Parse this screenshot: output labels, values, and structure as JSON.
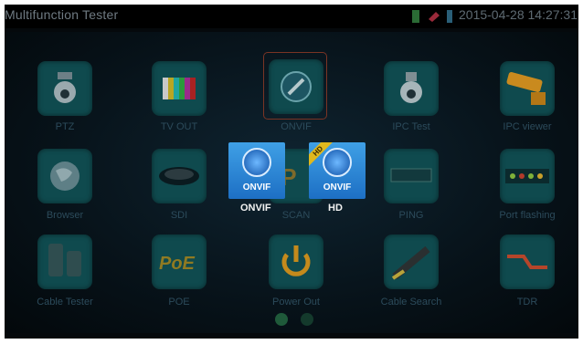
{
  "statusbar": {
    "title": "Multifunction Tester",
    "datetime": "2015-04-28 14:27:31",
    "icons": [
      "battery-icon",
      "charge-icon",
      "signal-icon"
    ]
  },
  "apps": [
    {
      "label": "PTZ",
      "icon": "ptz-camera-icon"
    },
    {
      "label": "TV OUT",
      "icon": "color-bars-icon"
    },
    {
      "label": "ONVIF",
      "icon": "onvif-icon"
    },
    {
      "label": "IPC Test",
      "icon": "ip-camera-icon"
    },
    {
      "label": "IPC viewer",
      "icon": "bullet-camera-icon"
    },
    {
      "label": "Browser",
      "icon": "globe-icon"
    },
    {
      "label": "SDI",
      "icon": "dome-camera-icon"
    },
    {
      "label": "SCAN",
      "icon": "ip-scan-icon"
    },
    {
      "label": "PING",
      "icon": "ping-icon"
    },
    {
      "label": "Port flashing",
      "icon": "port-lights-icon"
    },
    {
      "label": "Cable Tester",
      "icon": "cable-tester-icon"
    },
    {
      "label": "POE",
      "icon": "poe-icon"
    },
    {
      "label": "Power Out",
      "icon": "power-icon"
    },
    {
      "label": "Cable Search",
      "icon": "cable-search-icon"
    },
    {
      "label": "TDR",
      "icon": "tdr-icon"
    }
  ],
  "popup": {
    "onvif": {
      "tile_text": "ONVIF",
      "label": "ONVIF"
    },
    "onvif_hd": {
      "tile_text": "ONVIF",
      "label": "HD",
      "badge": "HD"
    }
  },
  "colors": {
    "tile": "#0f4a4e",
    "popup": "#2a86d8",
    "label": "#2c4b5b",
    "selection": "#7a3424"
  }
}
